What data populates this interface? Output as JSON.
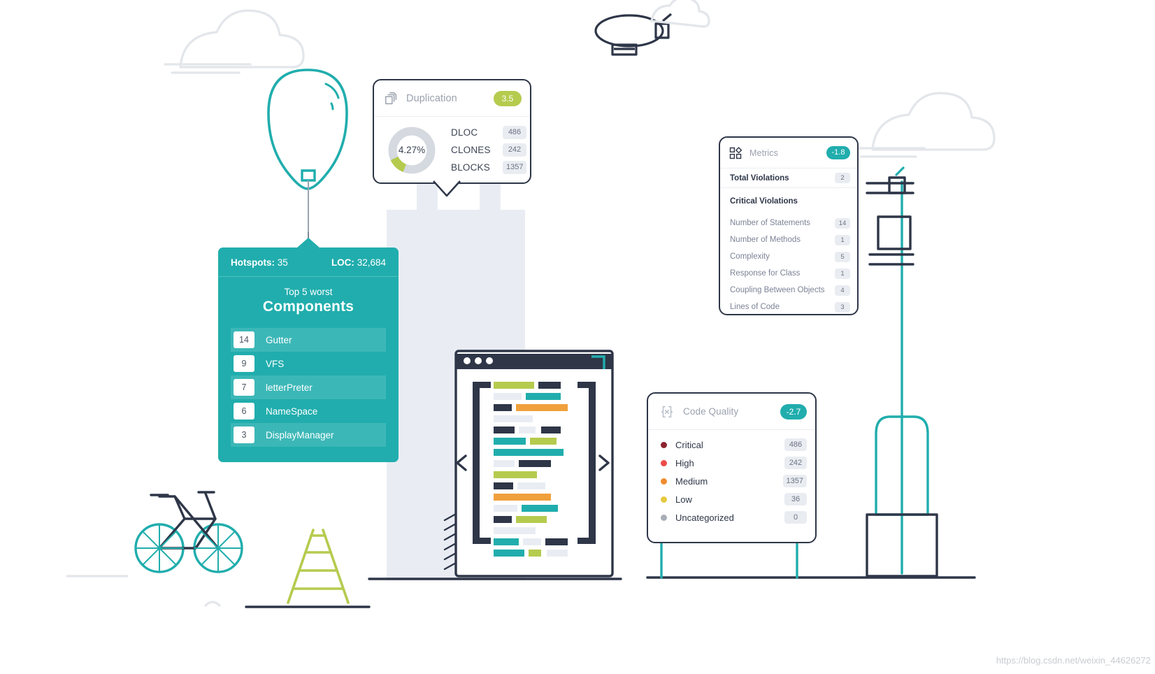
{
  "duplication": {
    "icon": "copy-stack-icon",
    "title": "Duplication",
    "badge": "3.5",
    "badge_color": "#b5cb4e",
    "donut_label": "4.27%",
    "donut_percent": 12,
    "rows": [
      {
        "label": "DLOC",
        "value": "486"
      },
      {
        "label": "CLONES",
        "value": "242"
      },
      {
        "label": "BLOCKS",
        "value": "1357"
      }
    ]
  },
  "components": {
    "hotspots_label": "Hotspots:",
    "hotspots_value": "35",
    "loc_label": "LOC:",
    "loc_value": "32,684",
    "subtitle": "Top 5 worst",
    "title": "Components",
    "accent_color": "#21adad",
    "items": [
      {
        "count": "14",
        "name": "Gutter"
      },
      {
        "count": "9",
        "name": "VFS"
      },
      {
        "count": "7",
        "name": "letterPreter"
      },
      {
        "count": "6",
        "name": "NameSpace"
      },
      {
        "count": "3",
        "name": "DisplayManager"
      }
    ]
  },
  "metrics": {
    "icon": "grid-diamond-icon",
    "title": "Metrics",
    "badge": "-1.8",
    "badge_color": "#21adad",
    "total_violations": {
      "label": "Total Violations",
      "value": "2"
    },
    "critical_violations_label": "Critical Violations",
    "rows": [
      {
        "label": "Number of Statements",
        "value": "14"
      },
      {
        "label": "Number of Methods",
        "value": "1"
      },
      {
        "label": "Complexity",
        "value": "5"
      },
      {
        "label": "Response for Class",
        "value": "1"
      },
      {
        "label": "Coupling Between Objects",
        "value": "4"
      },
      {
        "label": "Lines of Code",
        "value": "3"
      }
    ]
  },
  "quality": {
    "icon": "brackets-x-icon",
    "title": "Code Quality",
    "badge": "-2.7",
    "badge_color": "#21adad",
    "rows": [
      {
        "label": "Critical",
        "value": "486",
        "color": "#8c2230"
      },
      {
        "label": "High",
        "value": "242",
        "color": "#ef4b48"
      },
      {
        "label": "Medium",
        "value": "1357",
        "color": "#f08c2e"
      },
      {
        "label": "Low",
        "value": "36",
        "color": "#e6c93f"
      },
      {
        "label": "Uncategorized",
        "value": "0",
        "color": "#a8aeb8"
      }
    ]
  },
  "watermark": "https://blog.csdn.net/weixin_44626272"
}
